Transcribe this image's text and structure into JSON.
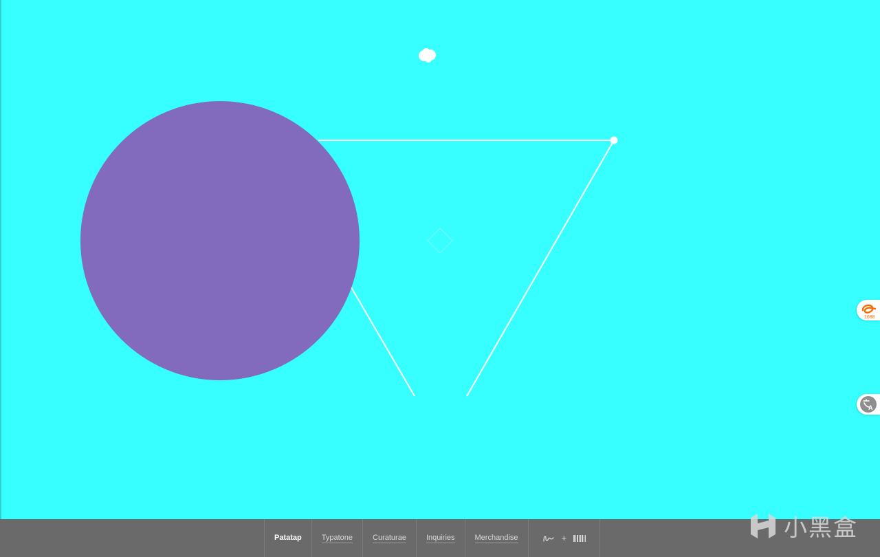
{
  "nav": {
    "items": [
      {
        "label": "Patatap",
        "active": true
      },
      {
        "label": "Typatone",
        "active": false
      },
      {
        "label": "Curaturae",
        "active": false
      },
      {
        "label": "Inquiries",
        "active": false
      },
      {
        "label": "Merchandise",
        "active": false
      }
    ],
    "tools": {
      "signature_icon": "signature-icon",
      "plus_label": "+",
      "barcode_icon": "barcode-icon"
    }
  },
  "canvas": {
    "background_color": "#37ffff",
    "circle_color": "#826abd",
    "line_color": "#ffffff"
  },
  "side_widgets": {
    "ext_1688_label": "1688",
    "translate_label": "A"
  },
  "watermark": {
    "text": "小黑盒"
  },
  "colors": {
    "bar_background": "#6a6a6a",
    "text_light": "#d8d8d8",
    "ext_orange": "#ff6a00"
  }
}
